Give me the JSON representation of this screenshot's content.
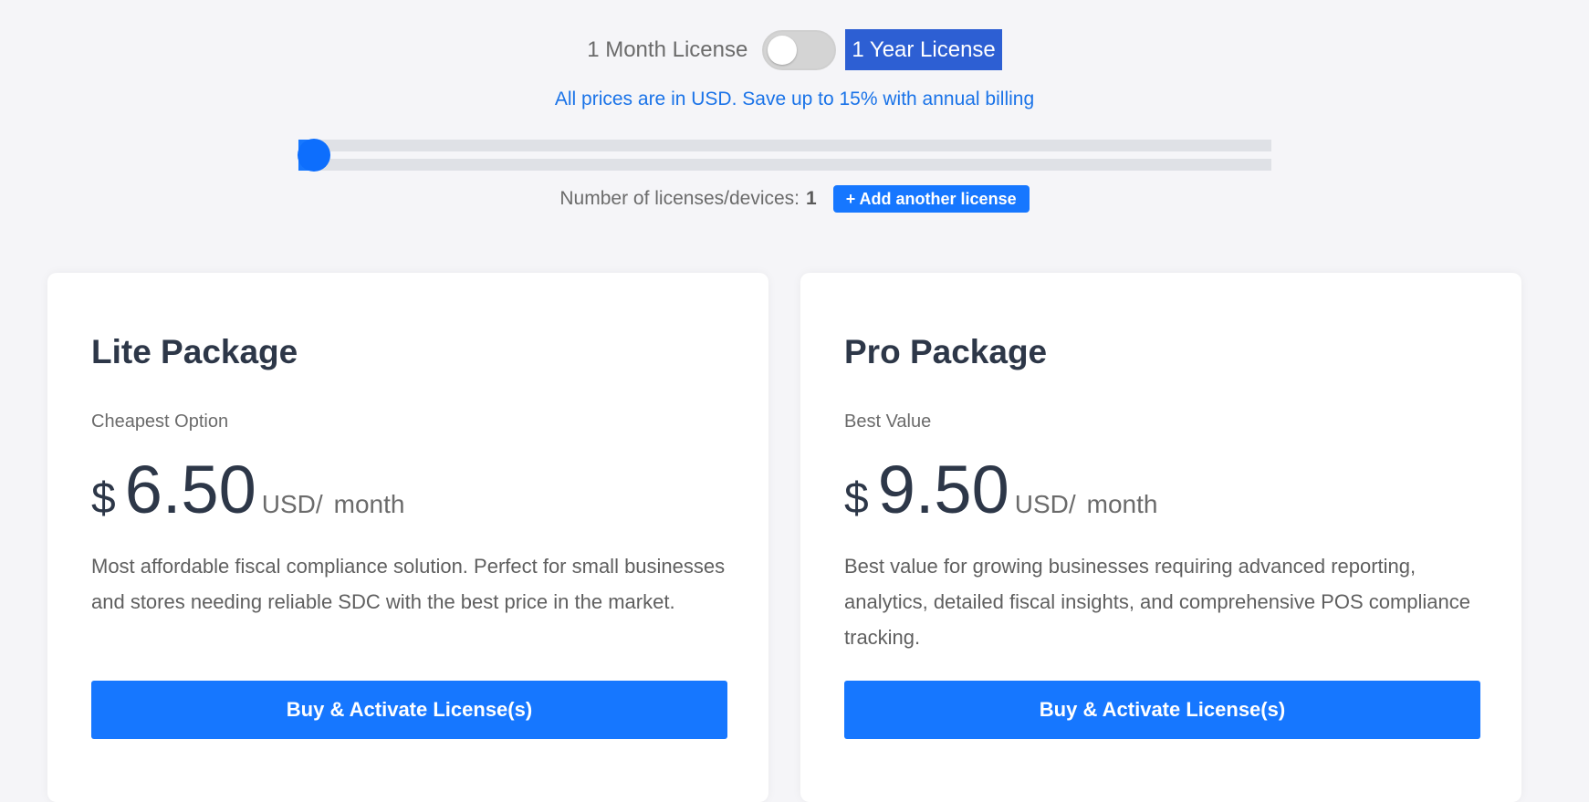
{
  "billing": {
    "month_label": "1 Month License",
    "year_label": "1 Year License",
    "toggle_on": false,
    "note": "All prices are in USD. Save up to 15% with annual billing"
  },
  "licenses": {
    "slider_value": 1,
    "slider_fill_fraction": 0.0,
    "label": "Number of licenses/devices:",
    "count": "1",
    "add_button": "+ Add another license"
  },
  "colors": {
    "accent": "#1677ff",
    "year_badge": "#2d5fd3",
    "note_text": "#1a73e8"
  },
  "packages": [
    {
      "title": "Lite Package",
      "tag": "Cheapest Option",
      "currency": "$",
      "amount": "6.50",
      "unit": "USD/",
      "period": "month",
      "description": "Most affordable fiscal compliance solution. Perfect for small businesses and stores needing reliable SDC with the best price in the market.",
      "button": "Buy & Activate License(s)"
    },
    {
      "title": "Pro Package",
      "tag": "Best Value",
      "currency": "$",
      "amount": "9.50",
      "unit": "USD/",
      "period": "month",
      "description": "Best value for growing businesses requiring advanced reporting, analytics, detailed fiscal insights, and comprehensive POS compliance tracking.",
      "button": "Buy & Activate License(s)"
    }
  ]
}
